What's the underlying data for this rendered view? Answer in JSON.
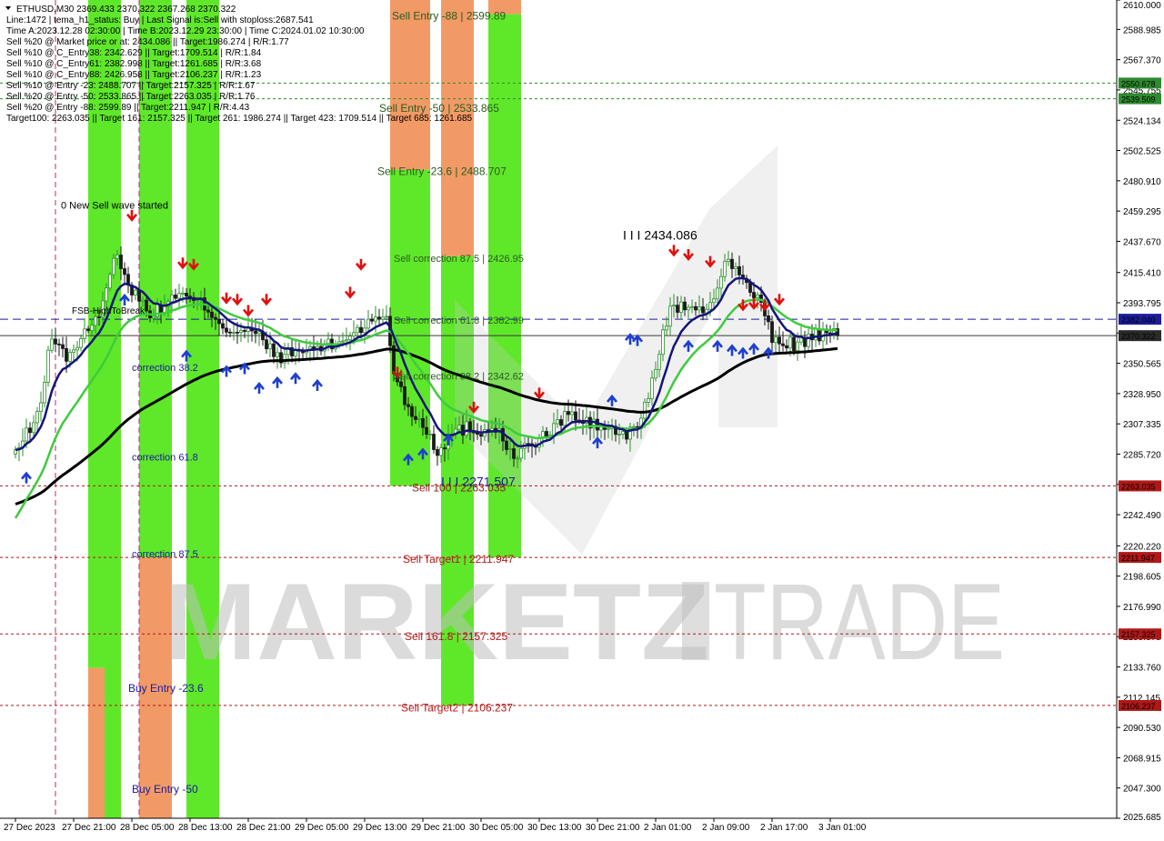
{
  "chart_data": {
    "type": "candlestick",
    "symbol": "ETHUSD,M30",
    "ohlc_header": "2369.433 2370.322 2367.268 2370.322",
    "ylim": [
      2025.685,
      2610.0
    ],
    "y_ticks": [
      "2610.000",
      "2588.985",
      "2567.370",
      "2545.755",
      "2524.134",
      "2502.525",
      "2480.910",
      "2459.295",
      "2437.670",
      "2415.410",
      "2393.795",
      "2372.180",
      "2350.565",
      "2328.950",
      "2307.335",
      "2285.720",
      "2264.105",
      "2242.490",
      "2220.220",
      "2198.605",
      "2176.990",
      "2155.375",
      "2133.760",
      "2112.145",
      "2090.530",
      "2068.915",
      "2047.300",
      "2025.685"
    ],
    "x_ticks": [
      {
        "label": "27 Dec 2023",
        "i": 0
      },
      {
        "label": "27 Dec 21:00",
        "i": 16
      },
      {
        "label": "28 Dec 05:00",
        "i": 32
      },
      {
        "label": "28 Dec 13:00",
        "i": 48
      },
      {
        "label": "28 Dec 21:00",
        "i": 64
      },
      {
        "label": "29 Dec 05:00",
        "i": 80
      },
      {
        "label": "29 Dec 13:00",
        "i": 96
      },
      {
        "label": "29 Dec 21:00",
        "i": 112
      },
      {
        "label": "30 Dec 05:00",
        "i": 128
      },
      {
        "label": "30 Dec 13:00",
        "i": 144
      },
      {
        "label": "30 Dec 21:00",
        "i": 160
      },
      {
        "label": "2 Jan 01:00",
        "i": 176
      },
      {
        "label": "2 Jan 09:00",
        "i": 192
      },
      {
        "label": "2 Jan 17:00",
        "i": 208
      },
      {
        "label": "3 Jan 01:00",
        "i": 224
      }
    ],
    "close_keypoints": [
      [
        0,
        2287
      ],
      [
        6,
        2312
      ],
      [
        10,
        2370
      ],
      [
        14,
        2355
      ],
      [
        22,
        2380
      ],
      [
        28,
        2430
      ],
      [
        32,
        2402
      ],
      [
        38,
        2385
      ],
      [
        44,
        2400
      ],
      [
        52,
        2392
      ],
      [
        58,
        2375
      ],
      [
        66,
        2372
      ],
      [
        72,
        2355
      ],
      [
        80,
        2360
      ],
      [
        88,
        2364
      ],
      [
        94,
        2375
      ],
      [
        102,
        2385
      ],
      [
        104,
        2345
      ],
      [
        108,
        2318
      ],
      [
        112,
        2308
      ],
      [
        116,
        2288
      ],
      [
        120,
        2300
      ],
      [
        124,
        2305
      ],
      [
        128,
        2302
      ],
      [
        132,
        2306
      ],
      [
        136,
        2285
      ],
      [
        142,
        2292
      ],
      [
        148,
        2304
      ],
      [
        152,
        2316
      ],
      [
        156,
        2308
      ],
      [
        162,
        2305
      ],
      [
        168,
        2298
      ],
      [
        172,
        2310
      ],
      [
        176,
        2348
      ],
      [
        180,
        2392
      ],
      [
        184,
        2390
      ],
      [
        188,
        2386
      ],
      [
        192,
        2398
      ],
      [
        196,
        2428
      ],
      [
        200,
        2408
      ],
      [
        204,
        2398
      ],
      [
        208,
        2368
      ],
      [
        214,
        2364
      ],
      [
        220,
        2370
      ],
      [
        226,
        2370.322
      ]
    ],
    "horizontal_levels": [
      {
        "value": 2550.678,
        "label": "2550.678",
        "color": "#2e8b2e",
        "style": "dotted"
      },
      {
        "value": 2539.509,
        "label": "2539.509",
        "color": "#2e8b2e",
        "style": "dotted"
      },
      {
        "value": 2382.04,
        "label": "2382.040",
        "color": "#1c1c9c",
        "style": "dashed"
      },
      {
        "value": 2370.322,
        "label": "2370.322",
        "color": "#3a3a3a",
        "style": "solid"
      },
      {
        "value": 2263.035,
        "label": "2263.035",
        "color": "#b01818",
        "style": "dotted"
      },
      {
        "value": 2211.947,
        "label": "2211.947",
        "color": "#b01818",
        "style": "dotted"
      },
      {
        "value": 2157.325,
        "label": "2157.325",
        "color": "#b01818",
        "style": "dotted"
      },
      {
        "value": 2106.237,
        "label": "2106.237",
        "color": "#b01818",
        "style": "dotted"
      }
    ],
    "zones": [
      {
        "i0": 20,
        "i1": 24.5,
        "segments": [
          {
            "lo": 2133,
            "hi": 2610,
            "color": "#5fe82a"
          },
          {
            "lo": 2025.685,
            "hi": 2133,
            "color": "#f29a66"
          }
        ]
      },
      {
        "i0": 24.5,
        "i1": 29,
        "segments": [
          {
            "lo": 2025.685,
            "hi": 2610,
            "color": "#5fe82a"
          }
        ]
      },
      {
        "i0": 34,
        "i1": 43,
        "segments": [
          {
            "lo": 2211.947,
            "hi": 2610,
            "color": "#5fe82a"
          },
          {
            "lo": 2025.685,
            "hi": 2211.947,
            "color": "#f29a66"
          }
        ]
      },
      {
        "i0": 47,
        "i1": 56,
        "segments": [
          {
            "lo": 2025.685,
            "hi": 2610,
            "color": "#5fe82a"
          }
        ]
      },
      {
        "i0": 103,
        "i1": 114,
        "segments": [
          {
            "lo": 2488.707,
            "hi": 2610,
            "color": "#f29a66"
          },
          {
            "lo": 2263.035,
            "hi": 2488.707,
            "color": "#5fe82a"
          }
        ]
      },
      {
        "i0": 117,
        "i1": 126,
        "segments": [
          {
            "lo": 2426.95,
            "hi": 2610,
            "color": "#f29a66"
          },
          {
            "lo": 2106.237,
            "hi": 2426.95,
            "color": "#5fe82a"
          }
        ]
      },
      {
        "i0": 130,
        "i1": 139,
        "segments": [
          {
            "lo": 2599.89,
            "hi": 2610,
            "color": "#f29a66"
          },
          {
            "lo": 2211.947,
            "hi": 2599.89,
            "color": "#5fe82a"
          }
        ]
      }
    ],
    "vertical_lines": [
      {
        "i": 11
      },
      {
        "i": 34
      }
    ],
    "annotations": [
      {
        "text": "Sell Entry -88 | 2599.89",
        "i": 103.5,
        "value": 2596,
        "color": "#2b5a1e",
        "size": 12
      },
      {
        "text": "Sell Entry -50 | 2533.865",
        "i": 100,
        "value": 2530,
        "color": "#2b5a1e",
        "size": 12
      },
      {
        "text": "Sell Entry -23.6 | 2488.707",
        "i": 99.5,
        "value": 2485,
        "color": "#2b5a1e",
        "size": 12
      },
      {
        "text": "Sell correction 87.5 | 2426.95",
        "i": 104,
        "value": 2423,
        "color": "#2b5a1e",
        "size": 11
      },
      {
        "text": "Sell correction 61.8 | 2382.99",
        "i": 104,
        "value": 2379,
        "color": "#2b5a1e",
        "size": 11
      },
      {
        "text": "Sell correction 38.2 | 2342.62",
        "i": 104,
        "value": 2339,
        "color": "#2b5a1e",
        "size": 11
      },
      {
        "text": "Sell 100 | 2263.035",
        "i": 109,
        "value": 2259,
        "color": "#8b1a1a",
        "size": 12
      },
      {
        "text": "Sell Target1 | 2211.947",
        "i": 106.5,
        "value": 2208,
        "color": "#b01818",
        "size": 12
      },
      {
        "text": "Sell 161.8 | 2157.325",
        "i": 107,
        "value": 2153,
        "color": "#b01818",
        "size": 12
      },
      {
        "text": "Sell Target2 | 2106.237",
        "i": 106,
        "value": 2102,
        "color": "#b01818",
        "size": 12
      },
      {
        "text": "0 New Sell wave started",
        "i": 12.5,
        "value": 2461,
        "color": "#000000",
        "size": 11
      },
      {
        "text": "FSB-HighToBreak",
        "i": 15.5,
        "value": 2386,
        "color": "#000000",
        "size": 10
      },
      {
        "text": "I I I 2434.086",
        "i": 167,
        "value": 2439,
        "color": "#000000",
        "size": 14
      },
      {
        "text": "I I I 2271.507",
        "i": 117,
        "value": 2263,
        "color": "#1a1a9c",
        "size": 14
      },
      {
        "text": "correction 38.2",
        "i": 32,
        "value": 2345,
        "color": "#1a1a9c",
        "size": 11
      },
      {
        "text": "correction 61.8",
        "i": 32,
        "value": 2281,
        "color": "#1a1a9c",
        "size": 11
      },
      {
        "text": "correction 87.5",
        "i": 32,
        "value": 2212,
        "color": "#1a1a9c",
        "size": 11
      },
      {
        "text": "Buy Entry -23.6",
        "i": 31,
        "value": 2116,
        "color": "#1a1a9c",
        "size": 12
      },
      {
        "text": "Buy Entry -50",
        "i": 32,
        "value": 2044,
        "color": "#1a1a9c",
        "size": 12
      }
    ],
    "sell_arrows": [
      [
        32,
        2453
      ],
      [
        46,
        2419
      ],
      [
        49,
        2418
      ],
      [
        58,
        2394
      ],
      [
        61,
        2393
      ],
      [
        64,
        2385
      ],
      [
        69,
        2393
      ],
      [
        92,
        2398
      ],
      [
        95,
        2418
      ],
      [
        105,
        2341
      ],
      [
        126,
        2316
      ],
      [
        144,
        2326
      ],
      [
        181,
        2428
      ],
      [
        185,
        2425
      ],
      [
        191,
        2420
      ],
      [
        200,
        2389
      ],
      [
        203,
        2390
      ],
      [
        206,
        2389
      ],
      [
        210,
        2393
      ]
    ],
    "buy_arrows": [
      [
        3,
        2272
      ],
      [
        30,
        2399
      ],
      [
        47,
        2359
      ],
      [
        58,
        2348
      ],
      [
        63,
        2350
      ],
      [
        67,
        2336
      ],
      [
        72,
        2340
      ],
      [
        77,
        2343
      ],
      [
        83,
        2338
      ],
      [
        108,
        2285
      ],
      [
        112,
        2289
      ],
      [
        119,
        2299
      ],
      [
        160,
        2297
      ],
      [
        164,
        2327
      ],
      [
        169,
        2371
      ],
      [
        171,
        2370
      ],
      [
        185,
        2366
      ],
      [
        193,
        2366
      ],
      [
        197,
        2363
      ],
      [
        200,
        2361
      ],
      [
        203,
        2364
      ],
      [
        207,
        2361
      ]
    ],
    "info_lines": [
      "ETHUSD,M30  2369.433 2370.322 2367.268 2370.322",
      "Line:1472 | tema_h1_status: Buy | Last Signal is:Sell with stoploss:2687.541",
      "Time A:2023.12.28 02:30:00 | Time B:2023.12.29 23:30:00 | Time C:2024.01.02 10:30:00",
      "Sell %20 @ Market price or at: 2434.086 || Target:1986.274 | R/R:1.77",
      "Sell %10 @ C_Entry38: 2342.629 || Target:1709.514 | R/R:1.84",
      "Sell %10 @ C_Entry61: 2382.998 || Target:1261.685 | R/R:3.68",
      "Sell %10 @ C_Entry88: 2426.958 || Target:2106.237 | R/R:1.23",
      "Sell %10 @ Entry -23: 2488.707 || Target:2157.325 | R/R:1.67",
      "Sell %20 @ Entry -50: 2533.865 || Target:2263.035 | R/R:1.76",
      "Sell %20 @ Entry -88: 2599.89 || Target:2211.947 | R/R:4.43",
      "Target100: 2263.035 || Target 161: 2157.325 || Target 261: 1986.274 || Target 423: 1709.514 || Target 685: 1261.685"
    ],
    "watermark": {
      "brand": "MARKETZ",
      "suffix": "TRADE"
    },
    "colors": {
      "background": "#ffffff",
      "bull": "#2f8f2f",
      "bear": "#1a1a1a",
      "ma_fast": "#14147a",
      "ma_mid": "#3fca3f",
      "ma_slow": "#000000",
      "sell_arrow": "#e01010",
      "buy_arrow": "#1f3fd0"
    }
  }
}
